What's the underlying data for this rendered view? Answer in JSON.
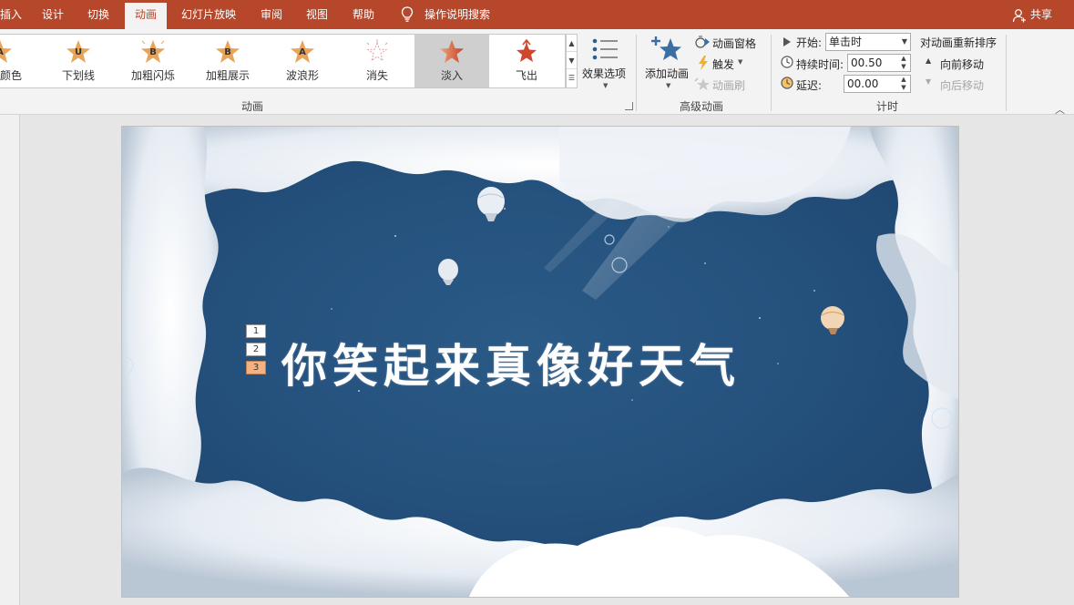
{
  "tabs": [
    {
      "label": "插入",
      "active": false
    },
    {
      "label": "设计",
      "active": false
    },
    {
      "label": "切换",
      "active": false
    },
    {
      "label": "动画",
      "active": true
    },
    {
      "label": "幻灯片放映",
      "active": false
    },
    {
      "label": "审阅",
      "active": false
    },
    {
      "label": "视图",
      "active": false
    },
    {
      "label": "帮助",
      "active": false
    }
  ],
  "tell_me": "操作说明搜索",
  "share": "共享",
  "animation_gallery": {
    "items": [
      {
        "label": "字体颜色",
        "letter": "A",
        "selected": false
      },
      {
        "label": "下划线",
        "letter": "U",
        "selected": false
      },
      {
        "label": "加粗闪烁",
        "letter": "B",
        "selected": false
      },
      {
        "label": "加粗展示",
        "letter": "B",
        "selected": false
      },
      {
        "label": "波浪形",
        "letter": "A",
        "selected": false
      },
      {
        "label": "消失",
        "letter": "",
        "selected": false
      },
      {
        "label": "淡入",
        "letter": "",
        "selected": true
      },
      {
        "label": "飞出",
        "letter": "",
        "selected": false
      }
    ],
    "group_label": "动画"
  },
  "effect_options": "效果选项",
  "advanced": {
    "add_animation": "添加动画",
    "animation_pane": "动画窗格",
    "trigger": "触发",
    "painter": "动画刷",
    "group_label": "高级动画"
  },
  "timing": {
    "start_label": "开始:",
    "start_value": "单击时",
    "duration_label": "持续时间:",
    "duration_value": "00.50",
    "delay_label": "延迟:",
    "delay_value": "00.00",
    "reorder_title": "对动画重新排序",
    "move_earlier": "向前移动",
    "move_later": "向后移动",
    "group_label": "计时"
  },
  "slide": {
    "title": "你笑起来真像好天气",
    "anim_tags": [
      "1",
      "2",
      "3"
    ]
  },
  "colors": {
    "accent": "#b7472a",
    "sky": "#2f5c86",
    "tag_selected": "#f4b183"
  }
}
